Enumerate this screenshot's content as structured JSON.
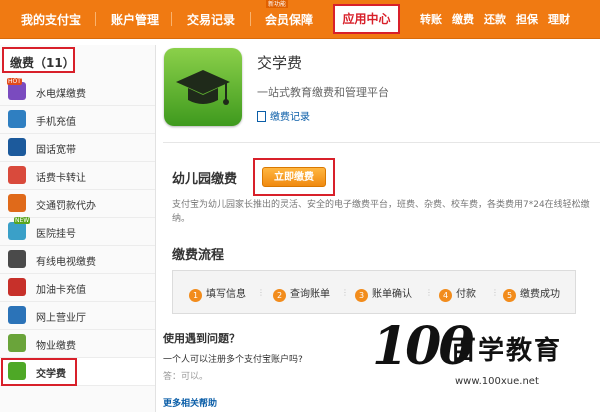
{
  "topnav": {
    "items": [
      "我的支付宝",
      "账户管理",
      "交易记录",
      "会员保障"
    ],
    "active": "应用中心",
    "quick": [
      "转账",
      "缴费",
      "还款",
      "担保",
      "理财"
    ],
    "tiny_label": "新功能"
  },
  "sidebar": {
    "header": "缴费（11）",
    "items": [
      {
        "label": "水电煤缴费",
        "icon": "utility-icon",
        "badge": "HOT"
      },
      {
        "label": "手机充值",
        "icon": "phone-icon"
      },
      {
        "label": "固话宽带",
        "icon": "landline-icon"
      },
      {
        "label": "话费卡转让",
        "icon": "phonecard-icon"
      },
      {
        "label": "交通罚款代办",
        "icon": "traffic-icon"
      },
      {
        "label": "医院挂号",
        "icon": "hospital-icon",
        "badge": "NEW"
      },
      {
        "label": "有线电视缴费",
        "icon": "tv-icon"
      },
      {
        "label": "加油卡充值",
        "icon": "fuel-icon"
      },
      {
        "label": "网上营业厅",
        "icon": "hall-icon"
      },
      {
        "label": "物业缴费",
        "icon": "property-icon"
      },
      {
        "label": "交学费",
        "icon": "tuition-icon"
      }
    ]
  },
  "app": {
    "title": "交学费",
    "subtitle": "一站式教育缴费和管理平台",
    "link": "缴费记录"
  },
  "section1": {
    "title": "幼儿园缴费",
    "button": "立即缴费",
    "description": "支付宝为幼儿园家长推出的灵活、安全的电子缴费平台，班费、杂费、校车费，各类费用7*24在线轻松缴纳。"
  },
  "flow": {
    "title": "缴费流程",
    "steps": [
      {
        "num": "1",
        "label": "填写信息"
      },
      {
        "num": "2",
        "label": "查询账单"
      },
      {
        "num": "3",
        "label": "账单确认"
      },
      {
        "num": "4",
        "label": "付款"
      },
      {
        "num": "5",
        "label": "缴费成功"
      }
    ]
  },
  "faq": {
    "title": "使用遇到问题？",
    "question": "一个人可以注册多个支付宝账户吗?",
    "answer": "答：可以。",
    "more": "更多相关帮助"
  },
  "watermark": {
    "number": "100",
    "brand": "百学教育",
    "url": "www.100xue.net"
  },
  "colors": {
    "nav_orange": "#f07a12",
    "highlight_red": "#d8202a",
    "link_blue": "#0b5ea8",
    "button_orange": "#f08a10"
  }
}
